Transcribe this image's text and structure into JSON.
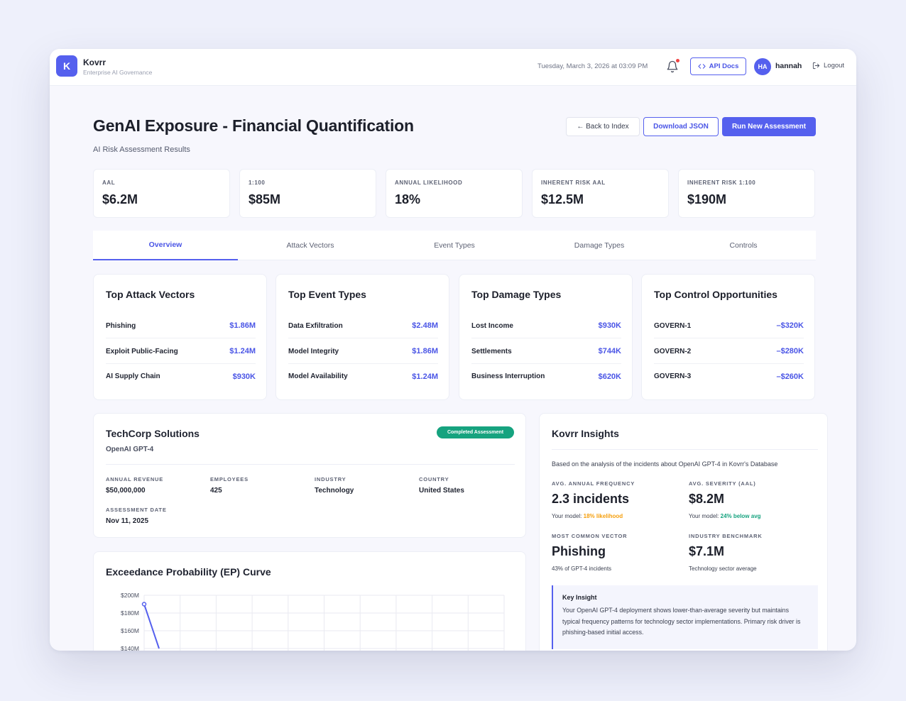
{
  "app": {
    "logo_letter": "K",
    "name": "Kovrr",
    "subtitle": "Enterprise AI Governance"
  },
  "topbar": {
    "datetime": "Tuesday, March 3, 2026 at 03:09 PM",
    "api_docs_label": "API Docs",
    "avatar_initials": "HA",
    "username": "hannah",
    "logout_label": "Logout"
  },
  "page": {
    "title": "GenAI Exposure - Financial Quantification",
    "subtitle": "AI Risk Assessment Results",
    "back_label": "← Back to Index",
    "download_label": "Download JSON",
    "run_label": "Run New Assessment"
  },
  "metrics": [
    {
      "label": "AAL",
      "value": "$6.2M"
    },
    {
      "label": "1:100",
      "value": "$85M"
    },
    {
      "label": "ANNUAL LIKELIHOOD",
      "value": "18%"
    },
    {
      "label": "INHERENT RISK AAL",
      "value": "$12.5M"
    },
    {
      "label": "INHERENT RISK 1:100",
      "value": "$190M"
    }
  ],
  "tabs": [
    {
      "label": "Overview"
    },
    {
      "label": "Attack Vectors"
    },
    {
      "label": "Event Types"
    },
    {
      "label": "Damage Types"
    },
    {
      "label": "Controls"
    }
  ],
  "cards": [
    {
      "title": "Top Attack Vectors",
      "rows": [
        {
          "name": "Phishing",
          "value": "$1.86M"
        },
        {
          "name": "Exploit Public-Facing",
          "value": "$1.24M"
        },
        {
          "name": "AI Supply Chain",
          "value": "$930K"
        }
      ]
    },
    {
      "title": "Top Event Types",
      "rows": [
        {
          "name": "Data Exfiltration",
          "value": "$2.48M"
        },
        {
          "name": "Model Integrity",
          "value": "$1.86M"
        },
        {
          "name": "Model Availability",
          "value": "$1.24M"
        }
      ]
    },
    {
      "title": "Top Damage Types",
      "rows": [
        {
          "name": "Lost Income",
          "value": "$930K"
        },
        {
          "name": "Settlements",
          "value": "$744K"
        },
        {
          "name": "Business Interruption",
          "value": "$620K"
        }
      ]
    },
    {
      "title": "Top Control Opportunities",
      "rows": [
        {
          "name": "GOVERN-1",
          "value": "–$320K"
        },
        {
          "name": "GOVERN-2",
          "value": "–$280K"
        },
        {
          "name": "GOVERN-3",
          "value": "–$260K"
        }
      ]
    }
  ],
  "company": {
    "name": "TechCorp Solutions",
    "model": "OpenAI GPT-4",
    "badge": "Completed Assessment",
    "fields": {
      "revenue_label": "ANNUAL REVENUE",
      "revenue": "$50,000,000",
      "employees_label": "EMPLOYEES",
      "employees": "425",
      "industry_label": "INDUSTRY",
      "industry": "Technology",
      "country_label": "COUNTRY",
      "country": "United States",
      "date_label": "ASSESSMENT DATE",
      "date": "Nov 11, 2025"
    }
  },
  "ep_curve": {
    "title": "Exceedance Probability (EP) Curve"
  },
  "chart_data": {
    "type": "line",
    "title": "Exceedance Probability (EP) Curve",
    "y_tick_labels": [
      "$200M",
      "$180M",
      "$160M",
      "$140M"
    ],
    "ylim": [
      140,
      200
    ],
    "y_unit": "$M",
    "grid": true,
    "series": [
      {
        "values": [
          190,
          140
        ]
      }
    ]
  },
  "insights": {
    "title": "Kovrr Insights",
    "intro": "Based on the analysis of the incidents about OpenAI GPT-4 in Kovrr's Database",
    "freq_label": "AVG. ANNUAL FREQUENCY",
    "freq_value": "2.3 incidents",
    "freq_note_prefix": "Your model: ",
    "freq_note_highlight": "18% likelihood",
    "sev_label": "AVG. SEVERITY (AAL)",
    "sev_value": "$8.2M",
    "sev_note_prefix": "Your model: ",
    "sev_note_highlight": "24% below avg",
    "vector_label": "MOST COMMON VECTOR",
    "vector_value": "Phishing",
    "vector_note": "43% of GPT-4 incidents",
    "bench_label": "INDUSTRY BENCHMARK",
    "bench_value": "$7.1M",
    "bench_note": "Technology sector average",
    "key_title": "Key Insight",
    "key_text": "Your OpenAI GPT-4 deployment shows lower-than-average severity but maintains typical frequency patterns for technology sector implementations. Primary risk driver is phishing-based initial access."
  },
  "colors": {
    "accent": "#5560ee",
    "success": "#16a37f",
    "warning": "#f59e0b",
    "notification": "#ef4444"
  }
}
